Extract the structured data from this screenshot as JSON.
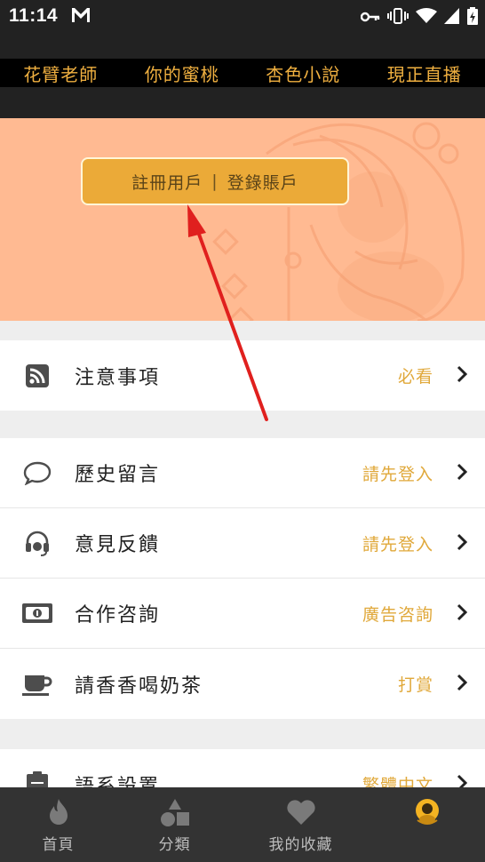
{
  "status_bar": {
    "time": "11:14"
  },
  "top_nav": {
    "items": [
      {
        "label": "花臂老師"
      },
      {
        "label": "你的蜜桃"
      },
      {
        "label": "杏色小說"
      },
      {
        "label": "現正直播"
      }
    ]
  },
  "banner": {
    "register_label": "註冊用戶",
    "login_label": "登錄賬戶"
  },
  "menu_group_1": [
    {
      "label": "注意事項",
      "value": "必看",
      "icon": "rss-icon"
    }
  ],
  "menu_group_2": [
    {
      "label": "歷史留言",
      "value": "請先登入",
      "icon": "chat-bubble-icon"
    },
    {
      "label": "意見反饋",
      "value": "請先登入",
      "icon": "headset-icon"
    },
    {
      "label": "合作咨詢",
      "value": "廣告咨詢",
      "icon": "banknote-icon"
    },
    {
      "label": "請香香喝奶茶",
      "value": "打賞",
      "icon": "coffee-cup-icon"
    }
  ],
  "menu_group_3": [
    {
      "label": "語系設置",
      "value": "繁體中文",
      "icon": "clipboard-icon"
    }
  ],
  "bottom_nav": {
    "tabs": [
      {
        "label": "首頁",
        "icon": "flame-icon"
      },
      {
        "label": "分類",
        "icon": "shapes-icon"
      },
      {
        "label": "我的收藏",
        "icon": "heart-icon"
      },
      {
        "label": "",
        "icon": "profile-avatar-icon"
      }
    ]
  },
  "colors": {
    "accent": "#e0a83a",
    "banner_bg": "#ffba92",
    "login_button_bg": "#ebaa38",
    "top_nav_text": "#f0b040",
    "annotation_arrow": "#e0201e"
  }
}
